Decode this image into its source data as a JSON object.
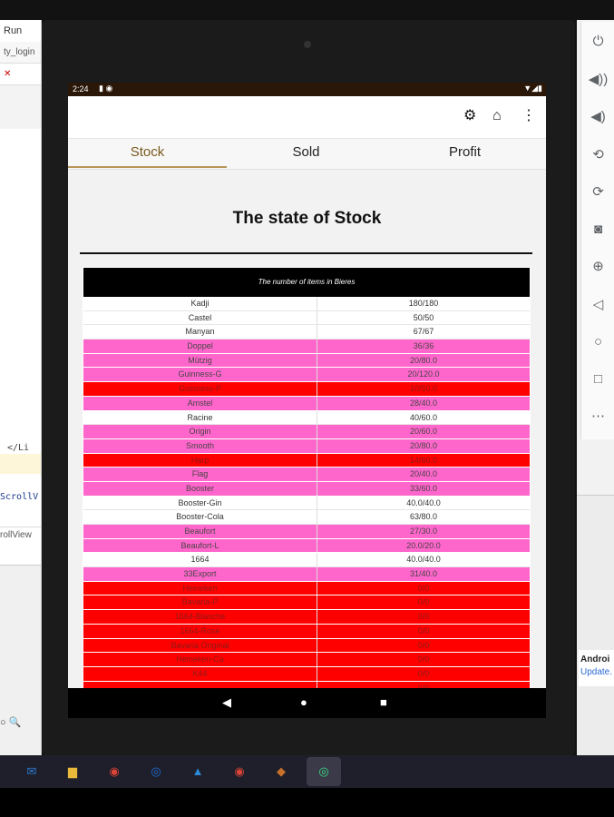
{
  "ide": {
    "menu_label": "Run",
    "tab_label": "ty_login",
    "code_line1": "</Li",
    "code_line2": "ScrollV",
    "breadcrumb": "rollView"
  },
  "emulator_controls": [
    {
      "icon": "power-icon",
      "glyph": "⏻"
    },
    {
      "icon": "volume-up-icon",
      "glyph": "🔊"
    },
    {
      "icon": "volume-down-icon",
      "glyph": "🔉"
    },
    {
      "icon": "rotate-left-icon",
      "glyph": "⟲"
    },
    {
      "icon": "rotate-right-icon",
      "glyph": "⟳"
    },
    {
      "icon": "camera-icon",
      "glyph": "📷"
    },
    {
      "icon": "zoom-icon",
      "glyph": "⊕"
    },
    {
      "icon": "back-icon",
      "glyph": "◁"
    },
    {
      "icon": "home-icon",
      "glyph": "○"
    },
    {
      "icon": "overview-icon",
      "glyph": "□"
    },
    {
      "icon": "more-icon",
      "glyph": "⋯"
    }
  ],
  "notification": {
    "title": "Androi",
    "link": "Update."
  },
  "statusbar": {
    "time": "2:24"
  },
  "appbar": {
    "icons": [
      "gear-icon",
      "home-icon",
      "more-vert-icon"
    ]
  },
  "tabs": [
    {
      "label": "Stock",
      "active": true
    },
    {
      "label": "Sold",
      "active": false
    },
    {
      "label": "Profit",
      "active": false
    }
  ],
  "page_title": "The state of Stock",
  "table": {
    "caption": "The number of items in Bieres",
    "rows": [
      {
        "name": "Kadji",
        "value": "180/180",
        "status": "ok"
      },
      {
        "name": "Castel",
        "value": "50/50",
        "status": "ok"
      },
      {
        "name": "Manyan",
        "value": "67/67",
        "status": "ok"
      },
      {
        "name": "Doppel",
        "value": "36/36",
        "status": "low"
      },
      {
        "name": "Mützig",
        "value": "20/80.0",
        "status": "low"
      },
      {
        "name": "Guinness-G",
        "value": "20/120.0",
        "status": "low"
      },
      {
        "name": "Guinness-P",
        "value": "10/50.0",
        "status": "out"
      },
      {
        "name": "Amstel",
        "value": "28/40.0",
        "status": "low"
      },
      {
        "name": "Racine",
        "value": "40/60.0",
        "status": "ok"
      },
      {
        "name": "Origin",
        "value": "20/60.0",
        "status": "low"
      },
      {
        "name": "Smooth",
        "value": "20/80.0",
        "status": "low"
      },
      {
        "name": "Harp",
        "value": "14/60.0",
        "status": "out"
      },
      {
        "name": "Flag",
        "value": "20/40.0",
        "status": "low"
      },
      {
        "name": "Booster",
        "value": "33/60.0",
        "status": "low"
      },
      {
        "name": "Booster-Gin",
        "value": "40.0/40.0",
        "status": "ok"
      },
      {
        "name": "Booster-Cola",
        "value": "63/80.0",
        "status": "ok"
      },
      {
        "name": "Beaufort",
        "value": "27/30.0",
        "status": "low"
      },
      {
        "name": "Beaufort-L",
        "value": "20.0/20.0",
        "status": "low"
      },
      {
        "name": "1664",
        "value": "40.0/40.0",
        "status": "ok"
      },
      {
        "name": "33Export",
        "value": "31/40.0",
        "status": "low"
      },
      {
        "name": "Heineken",
        "value": "0/0",
        "status": "out"
      },
      {
        "name": "Bavaria-P",
        "value": "0/0",
        "status": "out"
      },
      {
        "name": "1664-Blanche",
        "value": "0/0",
        "status": "out"
      },
      {
        "name": "1664-Rosé",
        "value": "0/0",
        "status": "out"
      },
      {
        "name": "Bavaria Original",
        "value": "0/0",
        "status": "out"
      },
      {
        "name": "Heineken-Ca",
        "value": "0/0",
        "status": "out"
      },
      {
        "name": "K44",
        "value": "0/0",
        "status": "out"
      },
      {
        "name": "",
        "value": "0/0",
        "status": "out"
      }
    ]
  },
  "navbar": {
    "icons": [
      "back-icon",
      "home-icon",
      "recents-icon"
    ]
  },
  "taskbar": [
    {
      "icon": "mail-icon",
      "glyph": "✉",
      "color": "#2b7cd3"
    },
    {
      "icon": "file-explorer-icon",
      "glyph": "▆",
      "color": "#e8b93a"
    },
    {
      "icon": "chrome-icon",
      "glyph": "◉",
      "color": "#db4437"
    },
    {
      "icon": "app-icon",
      "glyph": "◎",
      "color": "#1e6fd9"
    },
    {
      "icon": "photos-icon",
      "glyph": "▲",
      "color": "#2a8ad8"
    },
    {
      "icon": "chrome-icon",
      "glyph": "◉",
      "color": "#db4437"
    },
    {
      "icon": "paint-icon",
      "glyph": "◆",
      "color": "#c8702a"
    },
    {
      "icon": "android-studio-icon",
      "glyph": "◎",
      "color": "#3ddc84"
    }
  ],
  "colors": {
    "stock_ok": "#ffffff",
    "stock_low": "#ff66cc",
    "stock_out": "#ff0000",
    "tab_active": "#7a5a1e"
  }
}
